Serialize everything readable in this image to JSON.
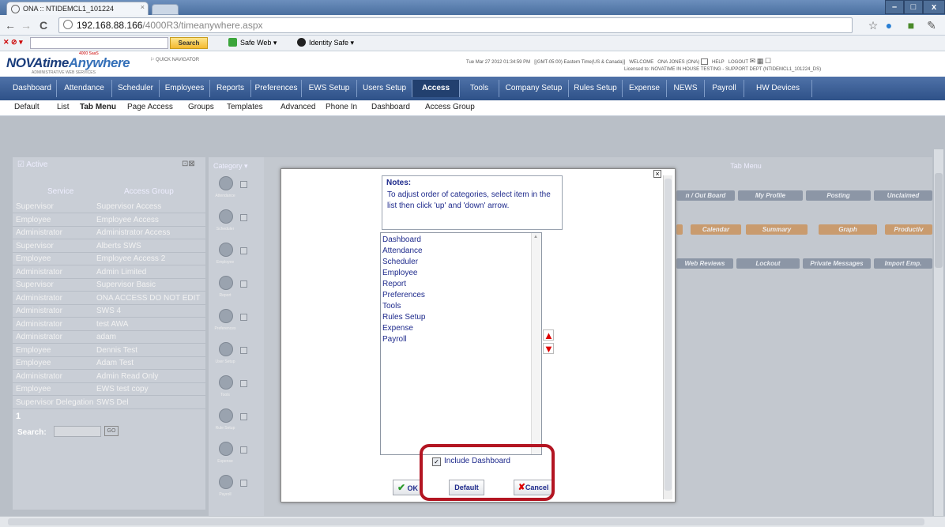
{
  "browser": {
    "tab_title": "ONA :: NTIDEMCL1_101224",
    "tab_close": "×",
    "url_host": "192.168.88.166",
    "url_path": "/4000R3/timeanywhere.aspx",
    "win_minimize": "–",
    "win_maximize": "□",
    "win_close": "x",
    "toolbar": {
      "search_label": "Search",
      "safe_web_label": "Safe Web ▾",
      "identity_safe_label": "Identity Safe ▾"
    }
  },
  "app": {
    "logo_text_1": "NOVAtime",
    "logo_text_2": "Anywhere",
    "logo_badge": "4000 SaaS",
    "logo_sub": "ADMINISTRATIVE WEB SERVICES",
    "quick_nav": "QUICK NAVIGATOR",
    "datetime": "Tue Mar 27 2012 01:34:59 PM",
    "timezone": "[(GMT-05:00) Eastern Time(US & Canada)]",
    "welcome": "WELCOME",
    "user": "ONA JONES (ONA)",
    "help": "HELP",
    "logout": "LOGOUT",
    "license": "Licensed to: NOVATIME IN HOUSE TESTING - SUPPORT DEPT (NTIDEMCL1_101224_DS)"
  },
  "main_nav": [
    "Dashboard",
    "Attendance",
    "Scheduler",
    "Employees",
    "Reports",
    "Preferences",
    "EWS Setup",
    "Users Setup",
    "Access",
    "Tools",
    "Company Setup",
    "Rules Setup",
    "Expense",
    "NEWS",
    "Payroll",
    "HW Devices"
  ],
  "sub_nav": [
    "Default",
    "List",
    "Tab Menu",
    "Page Access",
    "Groups",
    "Templates",
    "Advanced",
    "Phone In",
    "Dashboard",
    "Access Group"
  ],
  "left_panel": {
    "active_label": "Active",
    "col_service": "Service",
    "col_group": "Access Group",
    "rows": [
      [
        "Supervisor",
        "Supervisor Access"
      ],
      [
        "Employee",
        "Employee Access"
      ],
      [
        "Administrator",
        "Administrator Access"
      ],
      [
        "Supervisor",
        "Alberts SWS"
      ],
      [
        "Employee",
        "Employee Access 2"
      ],
      [
        "Administrator",
        "Admin Limited"
      ],
      [
        "Supervisor",
        "Supervisor Basic"
      ],
      [
        "Administrator",
        "ONA ACCESS DO NOT EDIT"
      ],
      [
        "Administrator",
        "SWS 4"
      ],
      [
        "Administrator",
        "test AWA"
      ],
      [
        "Administrator",
        "adam"
      ],
      [
        "Employee",
        "Dennis Test"
      ],
      [
        "Employee",
        "Adam Test"
      ],
      [
        "Administrator",
        "Admin Read Only"
      ],
      [
        "Employee",
        "EWS test copy"
      ],
      [
        "Supervisor Delegation",
        "SWS Del"
      ]
    ],
    "page": "1",
    "search_label": "Search:",
    "go_label": "GO"
  },
  "category": {
    "header": "Category",
    "items": [
      "Attendance",
      "Scheduler",
      "Employee",
      "Report",
      "Preferences",
      "User Setup",
      "Tools",
      "Rule Setup",
      "Expense",
      "Payroll"
    ]
  },
  "tab_menu": {
    "header": "Tab Menu",
    "row1": [
      "n / Out Board",
      "My Profile",
      "Posting",
      "Unclaimed"
    ],
    "row2": [
      "Calendar",
      "Summary",
      "Graph",
      "Productiv"
    ],
    "row3": [
      "Web Reviews",
      "Lockout",
      "Private Messages",
      "Import Emp."
    ]
  },
  "dialog": {
    "close": "×",
    "notes_title": "Notes:",
    "notes_body": "To adjust order of categories, select item in the list then click 'up' and 'down' arrow.",
    "list": [
      "Dashboard",
      "Attendance",
      "Scheduler",
      "Employee",
      "Report",
      "Preferences",
      "Tools",
      "Rules Setup",
      "Expense",
      "Payroll"
    ],
    "up_arrow": "▲",
    "down_arrow": "▼",
    "include_dashboard": "Include Dashboard",
    "ok": "OK",
    "default": "Default",
    "cancel": "Cancel",
    "ok_icon": "✔",
    "cancel_icon": "✘"
  },
  "colors": {
    "nav_blue": "#2e5188",
    "highlight_red": "#b31522",
    "dialog_text": "#1e2a8c"
  }
}
